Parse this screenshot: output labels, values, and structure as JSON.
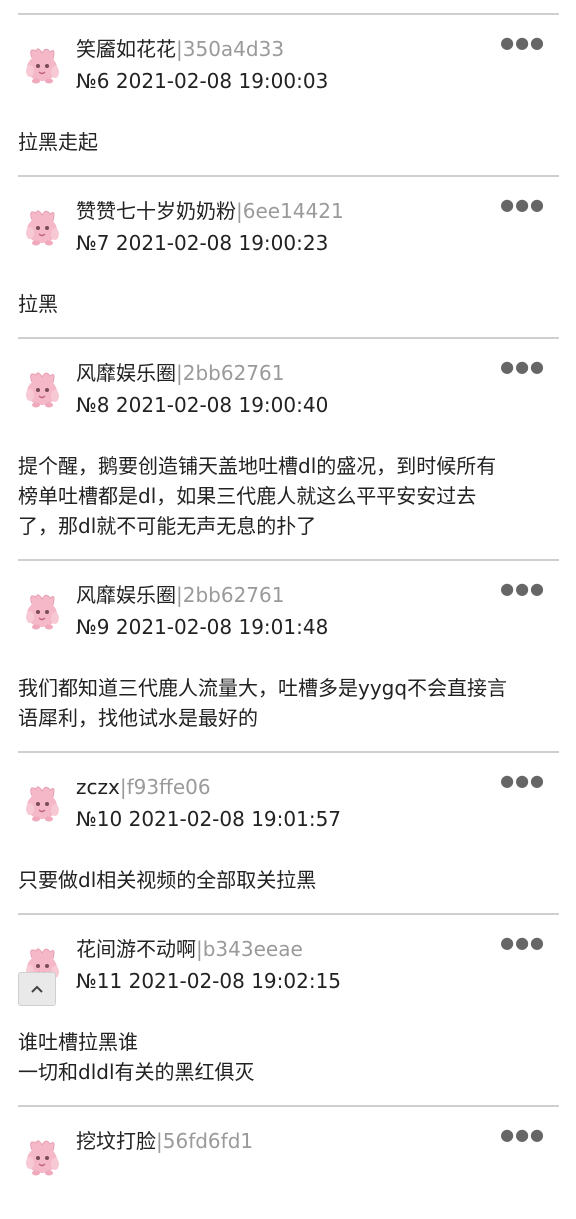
{
  "posts": [
    {
      "user": "笑靥如花花",
      "hash": "350a4d33",
      "no": "№6",
      "time": "2021-02-08 19:00:03",
      "content": [
        "拉黑走起"
      ]
    },
    {
      "user": "赞赞七十岁奶奶粉",
      "hash": "6ee14421",
      "no": "№7",
      "time": "2021-02-08 19:00:23",
      "content": [
        "拉黑"
      ]
    },
    {
      "user": "风靡娱乐圈",
      "hash": "2bb62761",
      "no": "№8",
      "time": "2021-02-08 19:00:40",
      "content": [
        "提个醒，鹅要创造铺天盖地吐槽dl的盛况，到时候所有",
        "榜单吐槽都是dl，如果三代鹿人就这么平平安安过去",
        "了，那dl就不可能无声无息的扑了"
      ]
    },
    {
      "user": "风靡娱乐圈",
      "hash": "2bb62761",
      "no": "№9",
      "time": "2021-02-08 19:01:48",
      "content": [
        "我们都知道三代鹿人流量大，吐槽多是yygq不会直接言",
        "语犀利，找他试水是最好的"
      ]
    },
    {
      "user": "zczx",
      "hash": "f93ffe06",
      "no": "№10",
      "time": "2021-02-08 19:01:57",
      "content": [
        "只要做dl相关视频的全部取关拉黑"
      ]
    },
    {
      "user": "花间游不动啊",
      "hash": "b343eeae",
      "no": "№11",
      "time": "2021-02-08 19:02:15",
      "content": [
        "谁吐槽拉黑谁",
        "一切和dldl有关的黑红俱灭"
      ]
    },
    {
      "user": "挖坟打脸",
      "hash": "56fd6fd1",
      "no": "",
      "time": "",
      "content": []
    }
  ],
  "icons": {
    "more": "more-dots-icon",
    "avatar": "pink-creature-avatar-icon",
    "scroll_top": "chevron-up-icon"
  },
  "colors": {
    "hash": "#9a9a9a",
    "divider": "#cfcfcf",
    "avatar": "#f4b8c8"
  }
}
